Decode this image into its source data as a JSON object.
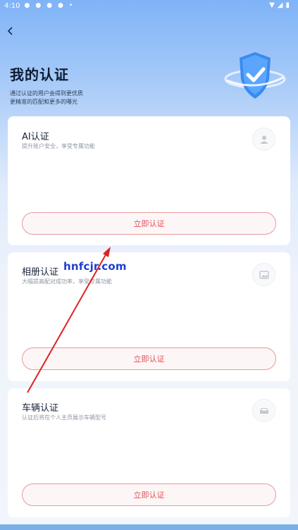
{
  "status_bar": {
    "time": "4:10",
    "left_icons": [
      "notification-icon",
      "notification-icon",
      "notification-icon",
      "notification-icon"
    ],
    "dot": "•",
    "right_icons": [
      "wifi-icon",
      "signal-icon",
      "battery-icon"
    ]
  },
  "header": {
    "title": "我的认证",
    "subtitle_line1": "通过认证的用户会得到更优质",
    "subtitle_line2": "更精准的匹配和更多的曝光"
  },
  "cards": [
    {
      "title": "AI认证",
      "desc": "提升账户安全，享受专属功能",
      "button": "立即认证",
      "icon": "person-icon"
    },
    {
      "title": "相册认证",
      "desc": "大幅提高配对成功率，享受专属功能",
      "button": "立即认证",
      "icon": "image-icon"
    },
    {
      "title": "车辆认证",
      "desc": "认证后将在个人主页展示车辆型号",
      "button": "立即认证",
      "icon": "car-icon"
    }
  ],
  "watermark": "hnfcjr.com",
  "colors": {
    "accent": "#e4505a",
    "button_border": "#e79a9e",
    "arrow": "#e02020"
  }
}
